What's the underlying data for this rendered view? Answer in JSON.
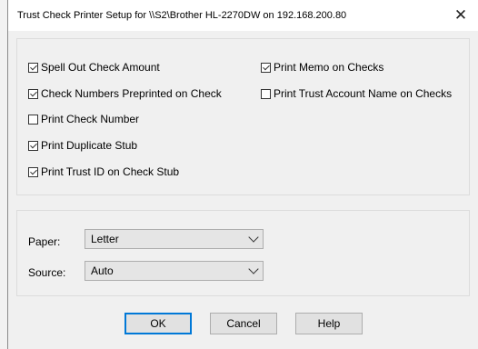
{
  "window": {
    "title": "Trust Check Printer Setup for \\\\S2\\Brother HL-2270DW on 192.168.200.80",
    "close_glyph": "✕"
  },
  "options": [
    {
      "label": "Spell Out Check Amount",
      "checked": true
    },
    {
      "label": "Check Numbers Preprinted on Check",
      "checked": true
    },
    {
      "label": "Print Check Number",
      "checked": false
    },
    {
      "label": "Print Duplicate Stub",
      "checked": true
    },
    {
      "label": "Print Trust ID on Check Stub",
      "checked": true
    },
    {
      "label": "Print Memo on Checks",
      "checked": true
    },
    {
      "label": "Print Trust Account Name on Checks",
      "checked": false
    }
  ],
  "paper": {
    "label": "Paper:",
    "value": "Letter"
  },
  "source": {
    "label": "Source:",
    "value": "Auto"
  },
  "buttons": {
    "ok": "OK",
    "cancel": "Cancel",
    "help": "Help"
  },
  "icons": {
    "close": "close-icon",
    "dropdown": "chevron-down-icon"
  }
}
